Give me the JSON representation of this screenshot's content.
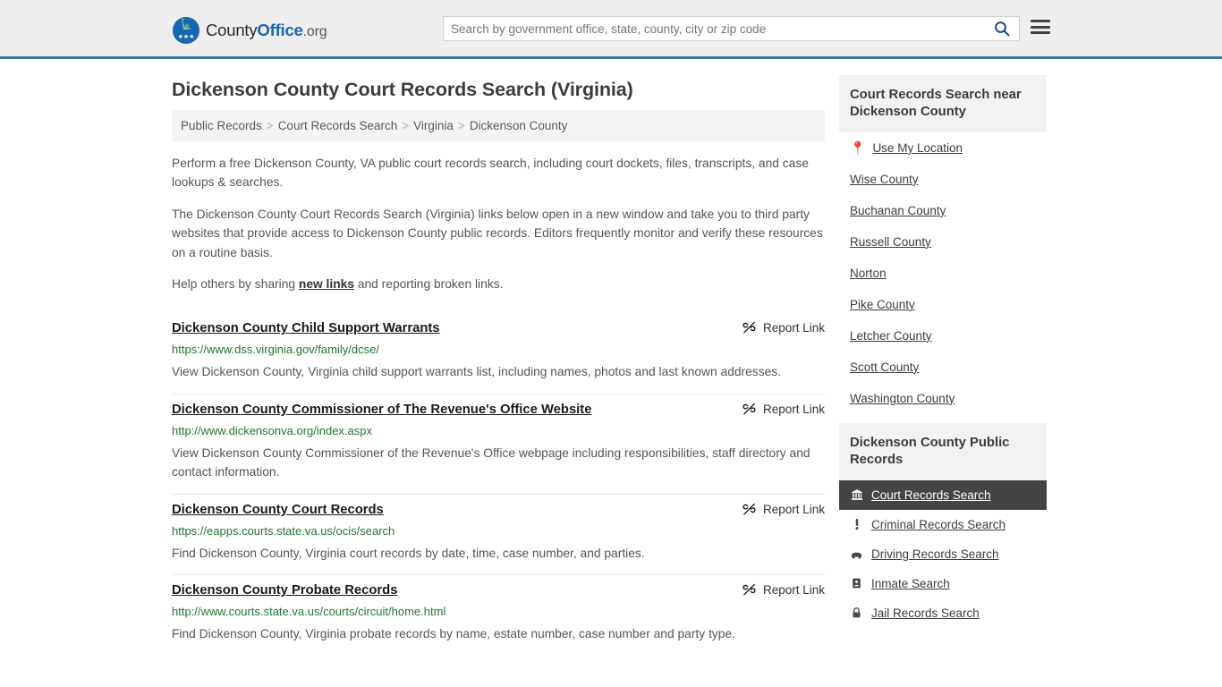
{
  "header": {
    "brand": {
      "part1": "County",
      "part2": "Office",
      "part3": ".org",
      "logo_icon": "eagle-stars-seal-icon"
    },
    "search": {
      "placeholder": "Search by government office, state, county, city or zip code",
      "value": "",
      "search_icon": "search-icon"
    },
    "menu_icon": "hamburger-menu-icon",
    "accent_color": "#3a72a8",
    "background_color": "#eeeeee"
  },
  "page_title": "Dickenson County Court Records Search (Virginia)",
  "breadcrumb": {
    "separator": ">",
    "items": [
      {
        "label": "Public Records"
      },
      {
        "label": "Court Records Search"
      },
      {
        "label": "Virginia"
      },
      {
        "label": "Dickenson County"
      }
    ]
  },
  "intro": {
    "paragraph1": "Perform a free Dickenson County, VA public court records search, including court dockets, files, transcripts, and case lookups & searches.",
    "paragraph2": "The Dickenson County Court Records Search (Virginia) links below open in a new window and take you to third party websites that provide access to Dickenson County public records. Editors frequently monitor and verify these resources on a routine basis.",
    "share_prefix": "Help others by sharing ",
    "share_link": "new links",
    "share_suffix": " and reporting broken links."
  },
  "report_link_label": "Report Link",
  "report_link_icon": "broken-link-icon",
  "results": [
    {
      "title": "Dickenson County Child Support Warrants",
      "url": "https://www.dss.virginia.gov/family/dcse/",
      "description": "View Dickenson County, Virginia child support warrants list, including names, photos and last known addresses."
    },
    {
      "title": "Dickenson County Commissioner of The Revenue's Office Website",
      "url": "http://www.dickensonva.org/index.aspx",
      "description": "View Dickenson County Commissioner of the Revenue's Office webpage including responsibilities, staff directory and contact information."
    },
    {
      "title": "Dickenson County Court Records",
      "url": "https://eapps.courts.state.va.us/ocis/search",
      "description": "Find Dickenson County, Virginia court records by date, time, case number, and parties."
    },
    {
      "title": "Dickenson County Probate Records",
      "url": "http://www.courts.state.va.us/courts/circuit/home.html",
      "description": "Find Dickenson County, Virginia probate records by name, estate number, case number and party type."
    }
  ],
  "sidebar": {
    "nearby": {
      "title": "Court Records Search near Dickenson County",
      "use_my_location": {
        "label": "Use My Location",
        "icon": "map-pin-icon"
      },
      "items": [
        {
          "label": "Wise County"
        },
        {
          "label": "Buchanan County"
        },
        {
          "label": "Russell County"
        },
        {
          "label": "Norton"
        },
        {
          "label": "Pike County"
        },
        {
          "label": "Letcher County"
        },
        {
          "label": "Scott County"
        },
        {
          "label": "Washington County"
        }
      ]
    },
    "public_records": {
      "title": "Dickenson County Public Records",
      "active_index": 0,
      "items": [
        {
          "label": "Court Records Search",
          "icon": "courthouse-icon",
          "active": true
        },
        {
          "label": "Criminal Records Search",
          "icon": "exclamation-icon",
          "active": false
        },
        {
          "label": "Driving Records Search",
          "icon": "car-icon",
          "active": false
        },
        {
          "label": "Inmate Search",
          "icon": "id-badge-icon",
          "active": false
        },
        {
          "label": "Jail Records Search",
          "icon": "lock-icon",
          "active": false
        }
      ]
    }
  }
}
